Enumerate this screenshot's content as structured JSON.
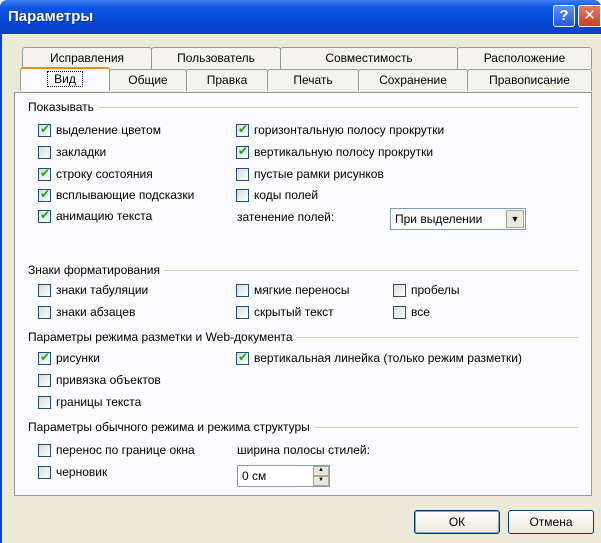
{
  "window": {
    "title": "Параметры",
    "help_glyph": "?",
    "close_glyph": "✕"
  },
  "tabs_row1": [
    "Исправления",
    "Пользователь",
    "Совместимость",
    "Расположение"
  ],
  "tabs_row2": [
    "Вид",
    "Общие",
    "Правка",
    "Печать",
    "Сохранение",
    "Правописание"
  ],
  "show": {
    "label": "Показывать",
    "items": [
      {
        "label": "выделение цветом",
        "checked": true
      },
      {
        "label": "закладки",
        "checked": false
      },
      {
        "label": "строку состояния",
        "checked": true
      },
      {
        "label": "всплывающие подсказки",
        "checked": true
      },
      {
        "label": "анимацию текста",
        "checked": true
      },
      {
        "label": "горизонтальную полосу прокрутки",
        "checked": true
      },
      {
        "label": "вертикальную полосу прокрутки",
        "checked": true
      },
      {
        "label": "пустые рамки рисунков",
        "checked": false
      },
      {
        "label": "коды полей",
        "checked": false
      }
    ],
    "shading_label": "затенение полей:",
    "shading_value": "При выделении"
  },
  "format": {
    "label": "Знаки форматирования",
    "items": [
      {
        "label": "знаки табуляции",
        "checked": false
      },
      {
        "label": "знаки абзацев",
        "checked": false
      },
      {
        "label": "мягкие переносы",
        "checked": false
      },
      {
        "label": "скрытый текст",
        "checked": false
      },
      {
        "label": "пробелы",
        "checked": false
      },
      {
        "label": "все",
        "checked": false
      }
    ]
  },
  "layout": {
    "label": "Параметры режима разметки и Web-документа",
    "items": [
      {
        "label": "рисунки",
        "checked": true
      },
      {
        "label": "привязка объектов",
        "checked": false
      },
      {
        "label": "границы текста",
        "checked": false
      },
      {
        "label": "вертикальная линейка (только режим разметки)",
        "checked": true
      }
    ]
  },
  "normal": {
    "label": "Параметры обычного режима и режима структуры",
    "items": [
      {
        "label": "перенос по границе окна",
        "checked": false
      },
      {
        "label": "черновик",
        "checked": false
      }
    ],
    "style_width_label": "ширина полосы стилей:",
    "style_width_value": "0 см"
  },
  "buttons": {
    "ok": "ОК",
    "cancel": "Отмена"
  }
}
